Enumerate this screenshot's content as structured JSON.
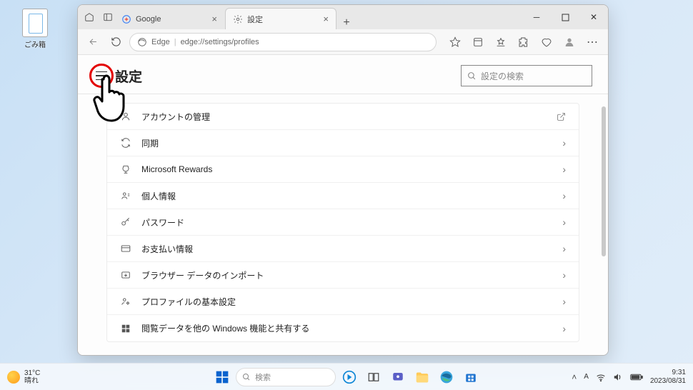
{
  "desktop": {
    "recycle_bin": "ごみ箱"
  },
  "browser_tabs": {
    "tab1": {
      "label": "Google"
    },
    "tab2": {
      "label": "設定"
    }
  },
  "address_bar": {
    "engine": "Edge",
    "url": "edge://settings/profiles"
  },
  "settings": {
    "title": "設定",
    "search_placeholder": "設定の検索",
    "rows": [
      {
        "label": "アカウントの管理",
        "action": "external"
      },
      {
        "label": "同期",
        "action": "chevron"
      },
      {
        "label": "Microsoft Rewards",
        "action": "chevron"
      },
      {
        "label": "個人情報",
        "action": "chevron"
      },
      {
        "label": "パスワード",
        "action": "chevron"
      },
      {
        "label": "お支払い情報",
        "action": "chevron"
      },
      {
        "label": "ブラウザー データのインポート",
        "action": "chevron"
      },
      {
        "label": "プロファイルの基本設定",
        "action": "chevron"
      },
      {
        "label": "閲覧データを他の Windows 機能と共有する",
        "action": "chevron"
      }
    ]
  },
  "taskbar": {
    "weather_temp": "31°C",
    "weather_label": "晴れ",
    "search_placeholder": "検索",
    "ime": "A",
    "time": "9:31",
    "date": "2023/08/31"
  }
}
